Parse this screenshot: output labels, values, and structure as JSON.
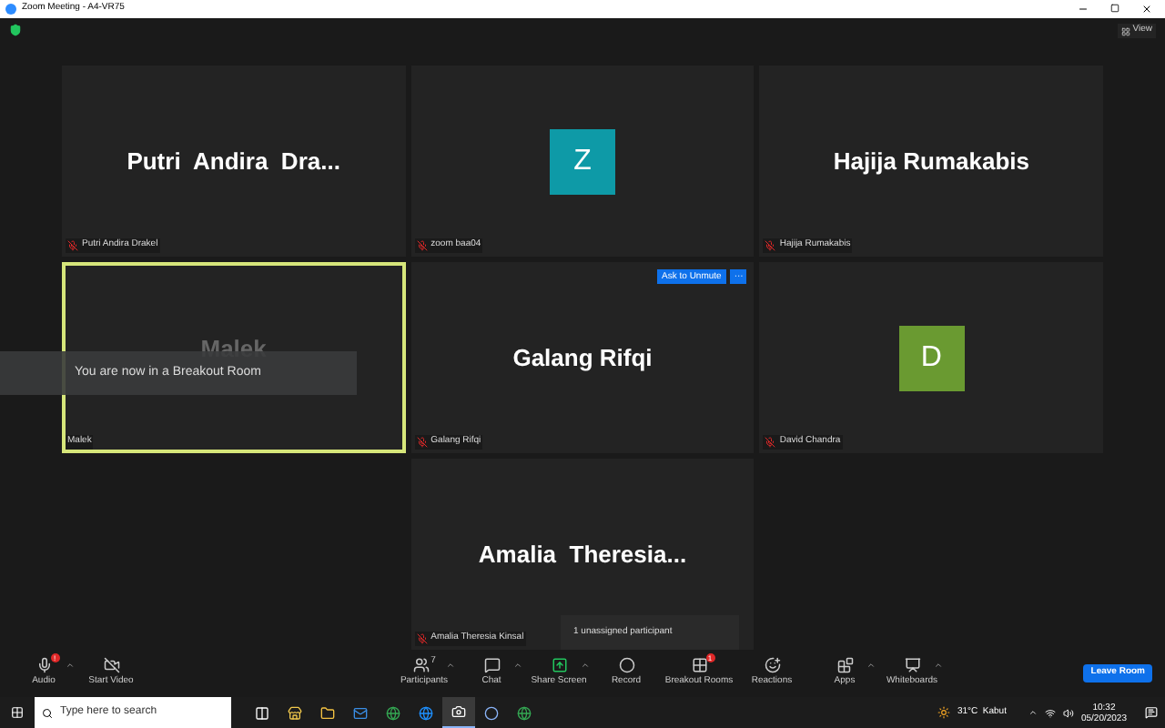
{
  "window": {
    "title": "Zoom Meeting - A4-VR75"
  },
  "top_bar": {
    "view_label": "View"
  },
  "tiles": [
    {
      "kind": "name",
      "display": "Putri  Andira  Dra...",
      "label": "Putri Andira Drakel",
      "muted": true,
      "speaking": false
    },
    {
      "kind": "avatar",
      "display": "Z",
      "color": "#0e9aa7",
      "label": "zoom baa04",
      "muted": true,
      "speaking": false
    },
    {
      "kind": "name",
      "display": "Hajija Rumakabis",
      "label": "Hajija Rumakabis",
      "muted": true,
      "speaking": false
    },
    {
      "kind": "name",
      "display": "Malek",
      "label": "Malek",
      "muted": false,
      "speaking": true,
      "dimmed": true
    },
    {
      "kind": "name",
      "display": "Galang Rifqi",
      "label": "Galang Rifqi",
      "muted": true,
      "speaking": false,
      "ask_to_unmute": "Ask to Unmute",
      "more": "···"
    },
    {
      "kind": "avatar",
      "display": "D",
      "color": "#6a9a31",
      "label": "David Chandra",
      "muted": true,
      "speaking": false
    },
    {
      "kind": "name",
      "display": "Amalia  Theresia...",
      "label": "Amalia Theresia Kinsal",
      "muted": true,
      "speaking": false
    }
  ],
  "toast": "You are now in a Breakout Room",
  "unassigned_popup": "1 unassigned participant",
  "toolbar": [
    {
      "kind": "audio",
      "label": "Audio",
      "badge": "!",
      "caret": true
    },
    {
      "kind": "video",
      "label": "Start Video",
      "caret": false
    },
    {
      "kind": "participants",
      "label": "Participants",
      "count": "7",
      "caret": true
    },
    {
      "kind": "chat",
      "label": "Chat",
      "caret": true
    },
    {
      "kind": "share",
      "label": "Share Screen",
      "caret": true
    },
    {
      "kind": "record",
      "label": "Record",
      "caret": false
    },
    {
      "kind": "breakout",
      "label": "Breakout Rooms",
      "badge": "1",
      "caret": false
    },
    {
      "kind": "reactions",
      "label": "Reactions",
      "caret": false
    },
    {
      "kind": "apps",
      "label": "Apps",
      "caret": true
    },
    {
      "kind": "whiteboards",
      "label": "Whiteboards",
      "caret": true
    }
  ],
  "leave_button": "Leave Room",
  "taskbar": {
    "search_placeholder": "Type here to search",
    "weather": "31°C  Kabut",
    "time": "10:32",
    "date": "05/20/2023",
    "apps": [
      {
        "kind": "taskview",
        "active": false
      },
      {
        "kind": "store",
        "active": false
      },
      {
        "kind": "folder",
        "active": false
      },
      {
        "kind": "mail",
        "active": false
      },
      {
        "kind": "chrome",
        "active": false
      },
      {
        "kind": "ie",
        "active": false
      },
      {
        "kind": "zoom",
        "active": true
      },
      {
        "kind": "camera",
        "active": false
      },
      {
        "kind": "chrome",
        "active": false
      }
    ]
  }
}
